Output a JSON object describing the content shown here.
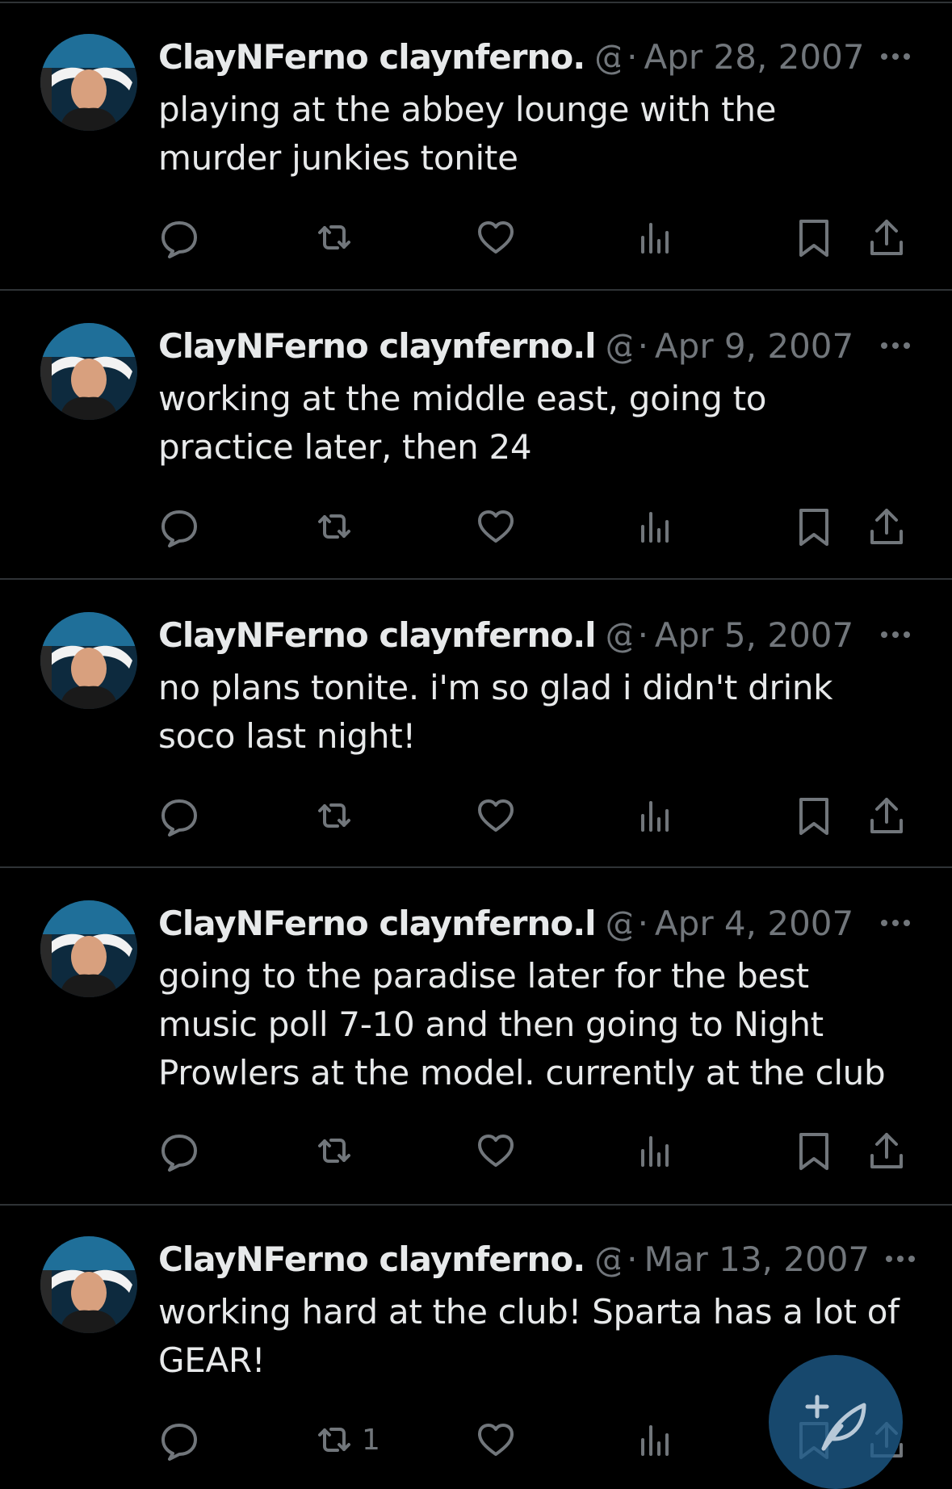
{
  "accent_color": "#1d9bf0",
  "fab": {
    "icon": "compose-feather-icon"
  },
  "tweets": [
    {
      "name": "ClayNFerno claynferno.",
      "handle": "@",
      "sep": "·",
      "time": "Apr 28, 2007",
      "text": "playing at the abbey lounge with the murder junkies tonite",
      "retweets": ""
    },
    {
      "name": "ClayNFerno claynferno.l",
      "handle": "@(",
      "sep": "·",
      "time": "Apr 9, 2007",
      "text": "working at the middle east, going to practice later, then 24",
      "retweets": ""
    },
    {
      "name": "ClayNFerno claynferno.l",
      "handle": "@(",
      "sep": "·",
      "time": "Apr 5, 2007",
      "text": "no plans tonite. i'm so glad i didn't drink soco last night!",
      "retweets": ""
    },
    {
      "name": "ClayNFerno claynferno.l",
      "handle": "@(",
      "sep": "·",
      "time": "Apr 4, 2007",
      "text": "going to the paradise later for the best music poll 7-10 and then going to Night Prowlers at the model. currently at the club",
      "retweets": ""
    },
    {
      "name": "ClayNFerno claynferno.",
      "handle": "@",
      "sep": "·",
      "time": "Mar 13, 2007",
      "text": "working hard at the club! Sparta has a lot of GEAR!",
      "retweets": "1"
    }
  ]
}
